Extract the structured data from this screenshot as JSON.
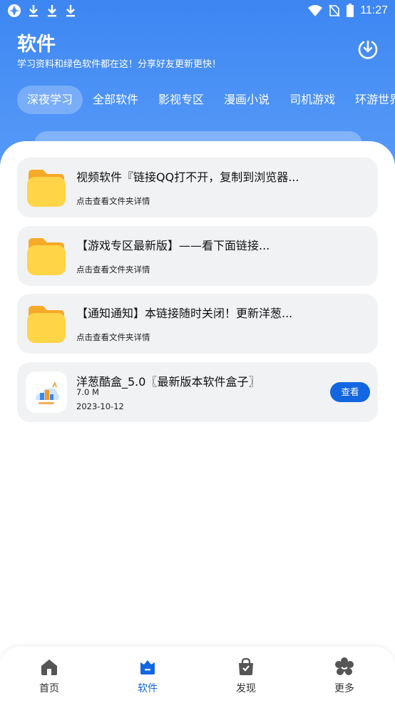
{
  "statusbar": {
    "time": "11:27",
    "left_icons": [
      "app-icon",
      "download-icon",
      "download-icon",
      "download-icon"
    ],
    "right_icons": [
      "wifi-icon",
      "no-sim-icon",
      "battery-icon"
    ]
  },
  "header": {
    "title": "软件",
    "subtitle": "学习资料和绿色软件都在这！分享好友更新更快！",
    "action_icon": "download-circle-icon"
  },
  "tabs": [
    {
      "label": "深夜学习",
      "active": true
    },
    {
      "label": "全部软件",
      "active": false
    },
    {
      "label": "影视专区",
      "active": false
    },
    {
      "label": "漫画小说",
      "active": false
    },
    {
      "label": "司机游戏",
      "active": false
    },
    {
      "label": "环游世界",
      "active": false
    }
  ],
  "list": {
    "folders": [
      {
        "title": "视频软件『链接QQ打不开，复制到浏览器...",
        "subtitle": "点击查看文件夹详情",
        "icon": "folder-icon"
      },
      {
        "title": "【游戏专区最新版】——看下面链接...",
        "subtitle": "点击查看文件夹详情",
        "icon": "folder-icon"
      },
      {
        "title": "【通知通知】本链接随时关闭！更新洋葱...",
        "subtitle": "点击查看文件夹详情",
        "icon": "folder-icon"
      }
    ],
    "app": {
      "title": "洋葱酷盒_5.0〖最新版本软件盒子〗",
      "size": "7.0 M",
      "date": "2023-10-12",
      "button": "查看",
      "icon": "onion-box-app-icon"
    }
  },
  "bottom_nav": [
    {
      "label": "首页",
      "icon": "home-icon",
      "active": false
    },
    {
      "label": "软件",
      "icon": "software-icon",
      "active": true
    },
    {
      "label": "发现",
      "icon": "discover-bag-icon",
      "active": false
    },
    {
      "label": "更多",
      "icon": "more-flower-icon",
      "active": false
    }
  ],
  "colors": {
    "header_blue": "#4a91f5",
    "accent": "#1266e0",
    "card_bg": "#f1f2f4",
    "folder_yellow": "#ffd447"
  }
}
